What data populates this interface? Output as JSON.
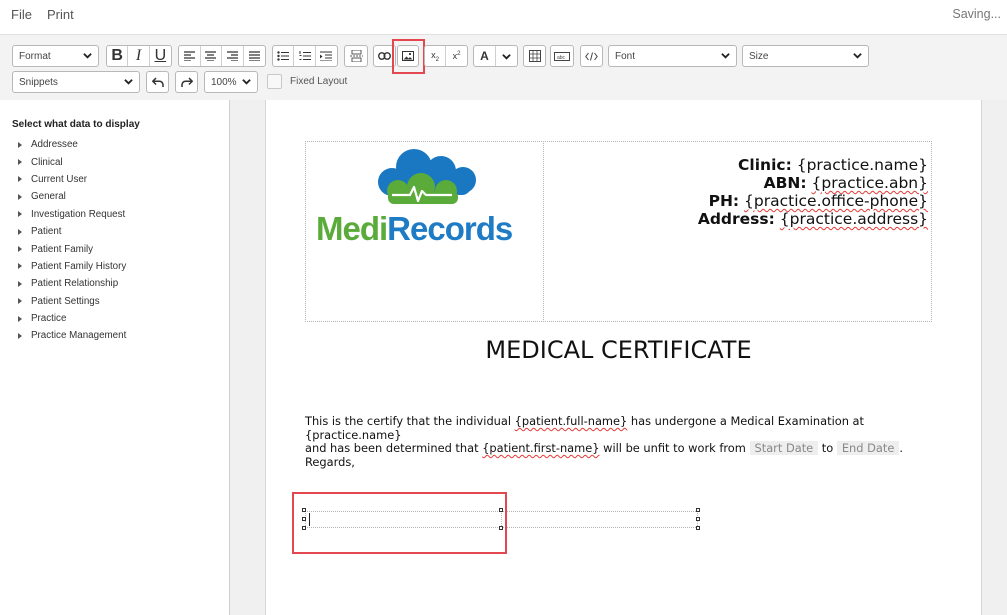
{
  "menu": {
    "file": "File",
    "print": "Print",
    "status": "Saving..."
  },
  "toolbar": {
    "format_label": "Format",
    "bold": "B",
    "italic": "I",
    "underline": "U",
    "text_color": "A",
    "font_label": "Font",
    "size_label": "Size",
    "snippets_label": "Snippets",
    "zoom_value": "100%",
    "fixed_layout_label": "Fixed Layout"
  },
  "sidebar": {
    "title": "Select what data to display",
    "items": [
      "Addressee",
      "Clinical",
      "Current User",
      "General",
      "Investigation Request",
      "Patient",
      "Patient Family",
      "Patient Family History",
      "Patient Relationship",
      "Patient Settings",
      "Practice",
      "Practice Management"
    ]
  },
  "document": {
    "logo": {
      "part1": "Medi",
      "part2": "Records",
      "color_part1": "#5aab3a",
      "color_part2": "#1e7bc4"
    },
    "clinic": {
      "clinic_label": "Clinic:",
      "clinic_value": "{practice.name}",
      "abn_label": "ABN:",
      "abn_value": "{practice.abn}",
      "ph_label": "PH:",
      "ph_value": "{practice.office-phone}",
      "address_label": "Address:",
      "address_value": "{practice.address}"
    },
    "title": "MEDICAL CERTIFICATE",
    "body": {
      "t1": "This is the certify that the individual ",
      "v1": "{patient.full-name}",
      "t2": " has undergone a Medical Examination at ",
      "v2": "{practice.name}",
      "t3": "and has been determined that ",
      "v3": "{patient.first-name}",
      "t4": " will be unfit to work from ",
      "start": "Start Date",
      "t5": " to ",
      "end": "End Date",
      "t6": ".",
      "regards": "Regards,"
    }
  },
  "colors": {
    "highlight": "#e3474f",
    "toolbar_bg": "#f3f3f3"
  }
}
